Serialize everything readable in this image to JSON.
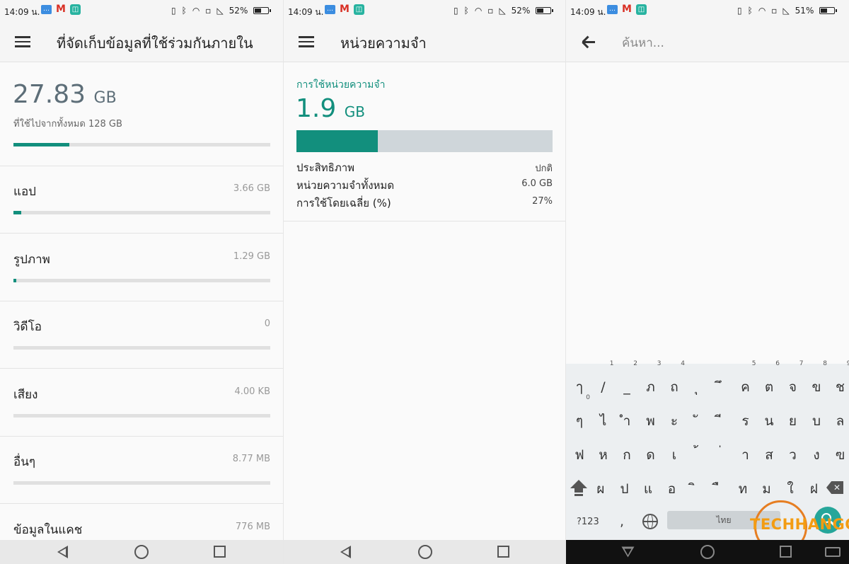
{
  "status_bars": [
    {
      "time": "14:09 น.",
      "battery": "52%",
      "battery_level": 0.52
    },
    {
      "time": "14:09 น.",
      "battery": "52%",
      "battery_level": 0.52
    },
    {
      "time": "14:09 น.",
      "battery": "51%",
      "battery_level": 0.51
    }
  ],
  "storage": {
    "title": "ที่จัดเก็บข้อมูลที่ใช้ร่วมกันภายใน",
    "used_value": "27.83",
    "used_unit": "GB",
    "used_of_total": "ที่ใช้ไปจากทั้งหมด 128 GB",
    "used_fraction": 0.2174,
    "items": [
      {
        "label": "แอป",
        "value": "3.66 GB",
        "fraction": 0.029
      },
      {
        "label": "รูปภาพ",
        "value": "1.29 GB",
        "fraction": 0.01
      },
      {
        "label": "วิดีโอ",
        "value": "0",
        "fraction": 0
      },
      {
        "label": "เสียง",
        "value": "4.00 KB",
        "fraction": 0
      },
      {
        "label": "อื่นๆ",
        "value": "8.77 MB",
        "fraction": 0
      },
      {
        "label": "ข้อมูลในแคช",
        "value": "776 MB",
        "fraction": 0.006
      }
    ]
  },
  "memory": {
    "title": "หน่วยความจำ",
    "usage_label": "การใช้หน่วยความจำ",
    "used_value": "1.9",
    "used_unit": "GB",
    "used_fraction": 0.317,
    "stats": [
      {
        "label": "ประสิทธิภาพ",
        "value": "ปกติ"
      },
      {
        "label": "หน่วยความจำทั้งหมด",
        "value": "6.0 GB"
      },
      {
        "label": "การใช้โดยเฉลี่ย (%)",
        "value": "27%"
      }
    ]
  },
  "search": {
    "placeholder": "ค้นหา..."
  },
  "keyboard": {
    "row1": [
      {
        "k": "ๅ",
        "s": ""
      },
      {
        "k": "/",
        "s": "1"
      },
      {
        "k": "_",
        "s": "2"
      },
      {
        "k": "ภ",
        "s": "3"
      },
      {
        "k": "ถ",
        "s": "4"
      },
      {
        "k": "ุ",
        "s": ""
      },
      {
        "k": "ึ",
        "s": ""
      },
      {
        "k": "ค",
        "s": "5"
      },
      {
        "k": "ต",
        "s": "6"
      },
      {
        "k": "จ",
        "s": "7"
      },
      {
        "k": "ข",
        "s": "8"
      },
      {
        "k": "ช",
        "s": "9"
      }
    ],
    "row2": [
      {
        "k": "ๆ",
        "s": "0"
      },
      {
        "k": "ไ",
        "s": ""
      },
      {
        "k": "ำ",
        "s": ""
      },
      {
        "k": "พ",
        "s": ""
      },
      {
        "k": "ะ",
        "s": ""
      },
      {
        "k": "ั",
        "s": ""
      },
      {
        "k": "ี",
        "s": ""
      },
      {
        "k": "ร",
        "s": ""
      },
      {
        "k": "น",
        "s": ""
      },
      {
        "k": "ย",
        "s": ""
      },
      {
        "k": "บ",
        "s": ""
      },
      {
        "k": "ล",
        "s": ""
      }
    ],
    "row3": [
      {
        "k": "ฟ",
        "s": ""
      },
      {
        "k": "ห",
        "s": ""
      },
      {
        "k": "ก",
        "s": ""
      },
      {
        "k": "ด",
        "s": ""
      },
      {
        "k": "เ",
        "s": ""
      },
      {
        "k": "้",
        "s": ""
      },
      {
        "k": "่",
        "s": ""
      },
      {
        "k": "า",
        "s": ""
      },
      {
        "k": "ส",
        "s": ""
      },
      {
        "k": "ว",
        "s": ""
      },
      {
        "k": "ง",
        "s": ""
      },
      {
        "k": "ฃ",
        "s": ""
      }
    ],
    "row4": [
      {
        "k": "ผ",
        "s": ""
      },
      {
        "k": "ป",
        "s": ""
      },
      {
        "k": "แ",
        "s": ""
      },
      {
        "k": "อ",
        "s": ""
      },
      {
        "k": "ิ",
        "s": ""
      },
      {
        "k": "ื",
        "s": ""
      },
      {
        "k": "ท",
        "s": ""
      },
      {
        "k": "ม",
        "s": ""
      },
      {
        "k": "ใ",
        "s": ""
      },
      {
        "k": "ฝ",
        "s": ""
      }
    ],
    "symbols_label": "?123",
    "comma": ",",
    "space_label": "ไทย"
  },
  "watermark": "TECHHANGOUT",
  "colors": {
    "accent": "#128f7d",
    "track": "#e0e0e0",
    "memory_track": "#cfd6da",
    "fab": "#26a69a"
  }
}
